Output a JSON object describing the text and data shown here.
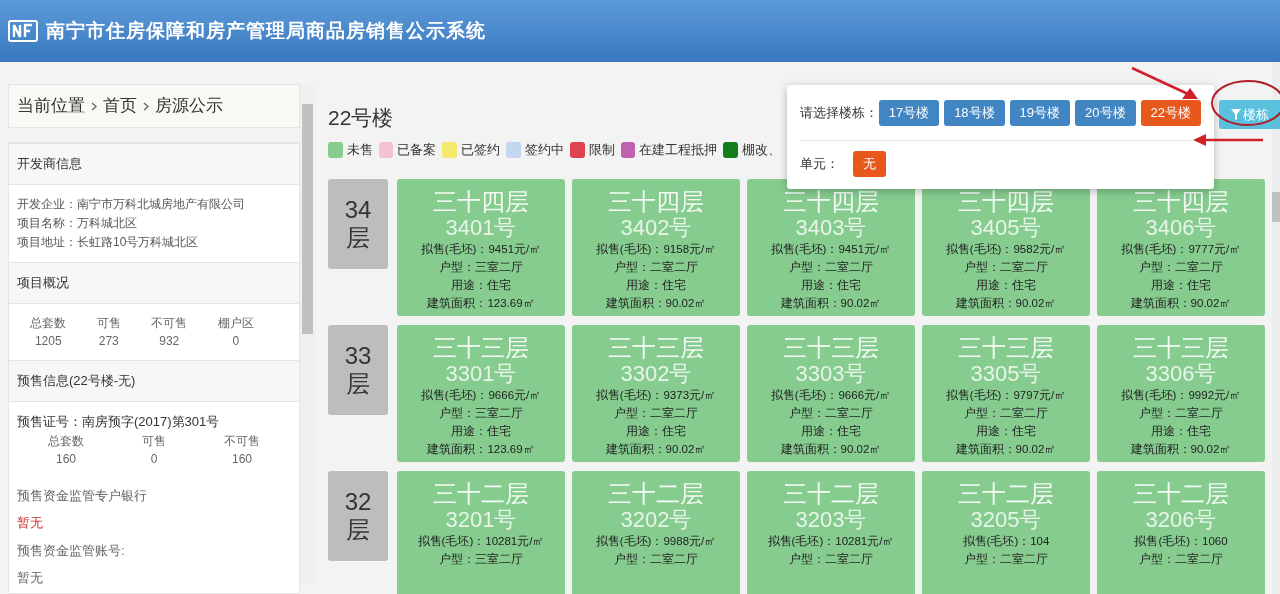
{
  "header": {
    "title": "南宁市住房保障和房产管理局商品房销售公示系统"
  },
  "breadcrumb": [
    "当前位置",
    "首页",
    "房源公示"
  ],
  "developer": {
    "heading": "开发商信息",
    "fields": [
      {
        "label": "开发企业：",
        "value": "南宁市万科北城房地产有限公司"
      },
      {
        "label": "项目名称：",
        "value": "万科城北区"
      },
      {
        "label": "项目地址：",
        "value": "长虹路10号万科城北区"
      }
    ]
  },
  "overview": {
    "heading": "项目概况",
    "stats": [
      {
        "label": "总套数",
        "value": "1205"
      },
      {
        "label": "可售",
        "value": "273"
      },
      {
        "label": "不可售",
        "value": "932"
      },
      {
        "label": "棚户区",
        "value": "0"
      }
    ]
  },
  "presale": {
    "heading": "预售信息(22号楼-无)",
    "permit": "预售证号：南房预字(2017)第301号",
    "stats": [
      {
        "label": "总套数",
        "value": "160"
      },
      {
        "label": "可售",
        "value": "0"
      },
      {
        "label": "不可售",
        "value": "160"
      }
    ],
    "bank_label": "预售资金监管专户银行",
    "bank_value": "暂无",
    "account_label": "预售资金监管账号:",
    "account_value": "暂无"
  },
  "building_title": "22号楼",
  "legend": [
    {
      "label": "未售",
      "color": "#86cc8f"
    },
    {
      "label": "已备案",
      "color": "#f4c2d2"
    },
    {
      "label": "已签约",
      "color": "#f3e96a"
    },
    {
      "label": "签约中",
      "color": "#c3d7ef"
    },
    {
      "label": "限制",
      "color": "#e0434f"
    },
    {
      "label": "在建工程抵押",
      "color": "#c061b0"
    },
    {
      "label": "棚改、",
      "color": "#137d1c"
    }
  ],
  "floors": [
    {
      "number": "34",
      "unit": "层",
      "rooms": [
        {
          "color": "#86cc8f",
          "floor_name": "三十四层",
          "room": "3401号",
          "lines": [
            "拟售(毛坯)：9451元/㎡",
            "户型：三室二厅",
            "用途：住宅",
            "建筑面积：123.69㎡"
          ]
        },
        {
          "color": "#86cc8f",
          "floor_name": "三十四层",
          "room": "3402号",
          "lines": [
            "拟售(毛坯)：9158元/㎡",
            "户型：二室二厅",
            "用途：住宅",
            "建筑面积：90.02㎡"
          ]
        },
        {
          "color": "#86cc8f",
          "floor_name": "三十四层",
          "room": "3403号",
          "lines": [
            "拟售(毛坯)：9451元/㎡",
            "户型：二室二厅",
            "用途：住宅",
            "建筑面积：90.02㎡"
          ]
        },
        {
          "color": "#86cc8f",
          "floor_name": "三十四层",
          "room": "3405号",
          "lines": [
            "拟售(毛坯)：9582元/㎡",
            "户型：二室二厅",
            "用途：住宅",
            "建筑面积：90.02㎡"
          ]
        },
        {
          "color": "#86cc8f",
          "floor_name": "三十四层",
          "room": "3406号",
          "lines": [
            "拟售(毛坯)：9777元/㎡",
            "户型：二室二厅",
            "用途：住宅",
            "建筑面积：90.02㎡"
          ]
        }
      ]
    },
    {
      "number": "33",
      "unit": "层",
      "rooms": [
        {
          "color": "#86cc8f",
          "floor_name": "三十三层",
          "room": "3301号",
          "lines": [
            "拟售(毛坯)：9666元/㎡",
            "户型：三室二厅",
            "用途：住宅",
            "建筑面积：123.69㎡"
          ]
        },
        {
          "color": "#86cc8f",
          "floor_name": "三十三层",
          "room": "3302号",
          "lines": [
            "拟售(毛坯)：9373元/㎡",
            "户型：二室二厅",
            "用途：住宅",
            "建筑面积：90.02㎡"
          ]
        },
        {
          "color": "#86cc8f",
          "floor_name": "三十三层",
          "room": "3303号",
          "lines": [
            "拟售(毛坯)：9666元/㎡",
            "户型：二室二厅",
            "用途：住宅",
            "建筑面积：90.02㎡"
          ]
        },
        {
          "color": "#86cc8f",
          "floor_name": "三十三层",
          "room": "3305号",
          "lines": [
            "拟售(毛坯)：9797元/㎡",
            "户型：二室二厅",
            "用途：住宅",
            "建筑面积：90.02㎡"
          ]
        },
        {
          "color": "#86cc8f",
          "floor_name": "三十三层",
          "room": "3306号",
          "lines": [
            "拟售(毛坯)：9992元/㎡",
            "户型：二室二厅",
            "用途：住宅",
            "建筑面积：90.02㎡"
          ]
        }
      ]
    },
    {
      "number": "32",
      "unit": "层",
      "rooms": [
        {
          "color": "#86cc8f",
          "floor_name": "三十二层",
          "room": "3201号",
          "lines": [
            "拟售(毛坯)：10281元/㎡",
            "户型：三室二厅"
          ]
        },
        {
          "color": "#86cc8f",
          "floor_name": "三十二层",
          "room": "3202号",
          "lines": [
            "拟售(毛坯)：9988元/㎡",
            "户型：二室二厅"
          ]
        },
        {
          "color": "#86cc8f",
          "floor_name": "三十二层",
          "room": "3203号",
          "lines": [
            "拟售(毛坯)：10281元/㎡",
            "户型：二室二厅"
          ]
        },
        {
          "color": "#86cc8f",
          "floor_name": "三十二层",
          "room": "3205号",
          "lines": [
            "拟售(毛坯)：104",
            "户型：二室二厅"
          ]
        },
        {
          "color": "#86cc8f",
          "floor_name": "三十二层",
          "room": "3206号",
          "lines": [
            "拟售(毛坯)：1060",
            "户型：二室二厅"
          ]
        }
      ]
    }
  ],
  "selector": {
    "building_label": "请选择楼栋：",
    "buildings": [
      {
        "label": "17号楼",
        "selected": false
      },
      {
        "label": "18号楼",
        "selected": false
      },
      {
        "label": "19号楼",
        "selected": false
      },
      {
        "label": "20号楼",
        "selected": false
      },
      {
        "label": "22号楼",
        "selected": true
      }
    ],
    "unit_label": "单元：",
    "units": [
      {
        "label": "无",
        "selected": true
      }
    ]
  },
  "filter_button": {
    "label": "楼栋"
  },
  "annotations": [
    {
      "kind": "arrow"
    },
    {
      "kind": "arrow"
    },
    {
      "kind": "circle"
    }
  ]
}
